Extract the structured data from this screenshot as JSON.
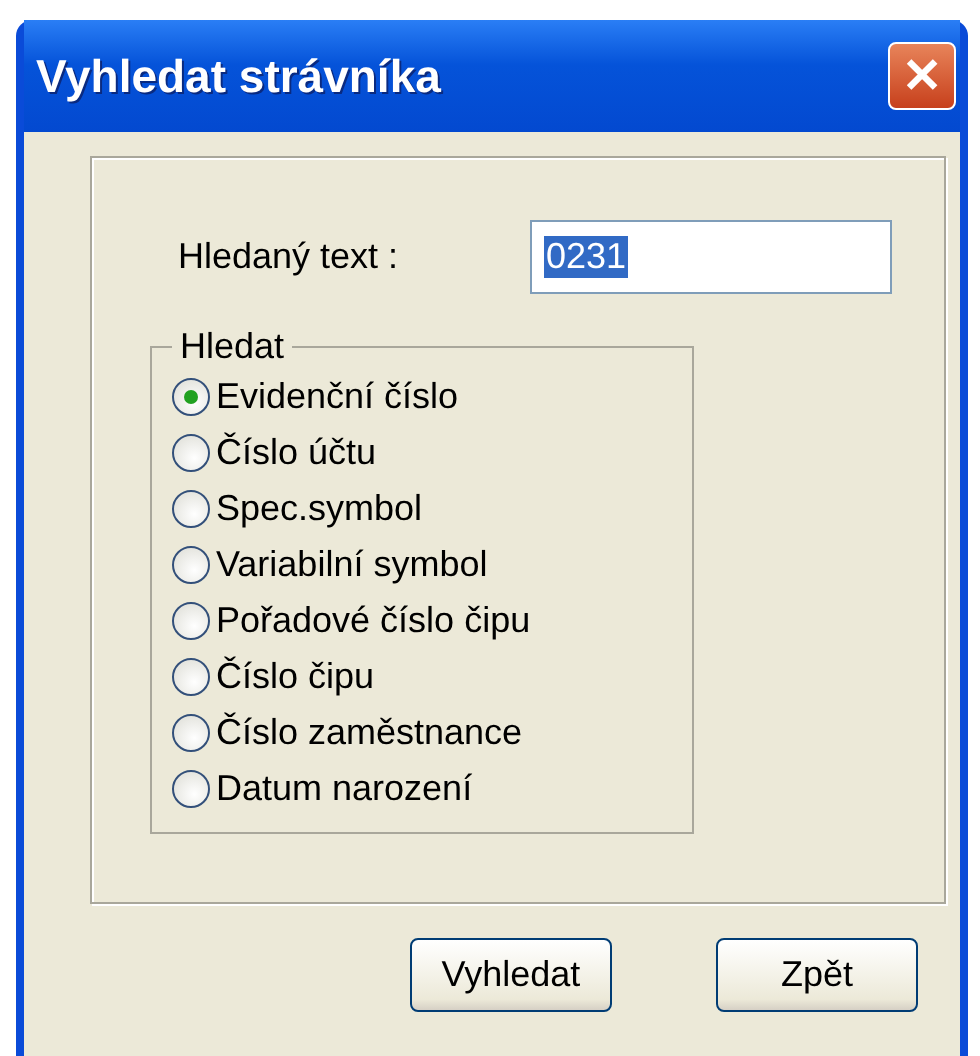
{
  "window": {
    "title": "Vyhledat strávníka",
    "close_symbol": "✕"
  },
  "search": {
    "label": "Hledaný text :",
    "value": "0231",
    "value_selected": true
  },
  "group": {
    "title": "Hledat",
    "options": [
      {
        "label": "Evidenční číslo",
        "selected": true
      },
      {
        "label": "Číslo účtu",
        "selected": false
      },
      {
        "label": "Spec.symbol",
        "selected": false
      },
      {
        "label": "Variabilní symbol",
        "selected": false
      },
      {
        "label": "Pořadové číslo čipu",
        "selected": false
      },
      {
        "label": "Číslo čipu",
        "selected": false
      },
      {
        "label": "Číslo zaměstnance",
        "selected": false
      },
      {
        "label": "Datum narození",
        "selected": false
      }
    ]
  },
  "buttons": [
    "Vyhledat",
    "Zpět"
  ]
}
